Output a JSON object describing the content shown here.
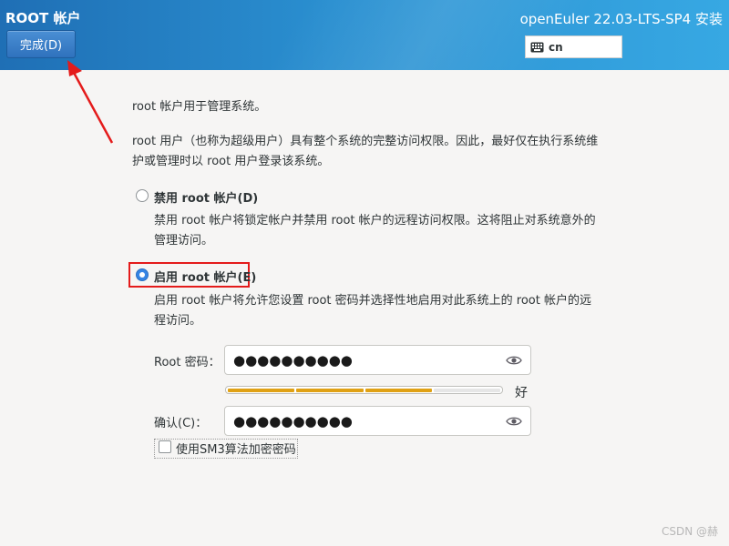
{
  "header": {
    "title": "ROOT 帐户",
    "done_button": "完成(D)",
    "product": "openEuler 22.03-LTS-SP4 安装",
    "keyboard_icon": "keyboard-icon",
    "keyboard_layout": "cn"
  },
  "content": {
    "intro_line1": "root 帐户用于管理系统。",
    "intro_line2": "root 用户（也称为超级用户）具有整个系统的完整访问权限。因此，最好仅在执行系统维护或管理时以 root 用户登录该系统。",
    "disable_option": {
      "label": "禁用 root 帐户(D)",
      "selected": false,
      "description": "禁用 root 帐户将锁定帐户并禁用 root 帐户的远程访问权限。这将阻止对系统意外的管理访问。"
    },
    "enable_option": {
      "label": "启用 root 帐户(E)",
      "selected": true,
      "description": "启用 root 帐户将允许您设置 root 密码并选择性地启用对此系统上的 root 帐户的远程访问。"
    },
    "root_password": {
      "label": "Root 密码：",
      "value": "●●●●●●●●●●",
      "reveal_icon": "eye-icon"
    },
    "strength": {
      "level": 0.75,
      "segments_total": 4,
      "segments_on": 3,
      "label": "好",
      "color": "#e0a114"
    },
    "confirm_password": {
      "label": "确认(C)：",
      "value": "●●●●●●●●●●",
      "reveal_icon": "eye-icon"
    },
    "sm3_checkbox": {
      "label": "使用SM3算法加密密码",
      "checked": false
    }
  },
  "annotation": {
    "highlight_color": "#e41b1b"
  },
  "watermark": "CSDN @赫"
}
